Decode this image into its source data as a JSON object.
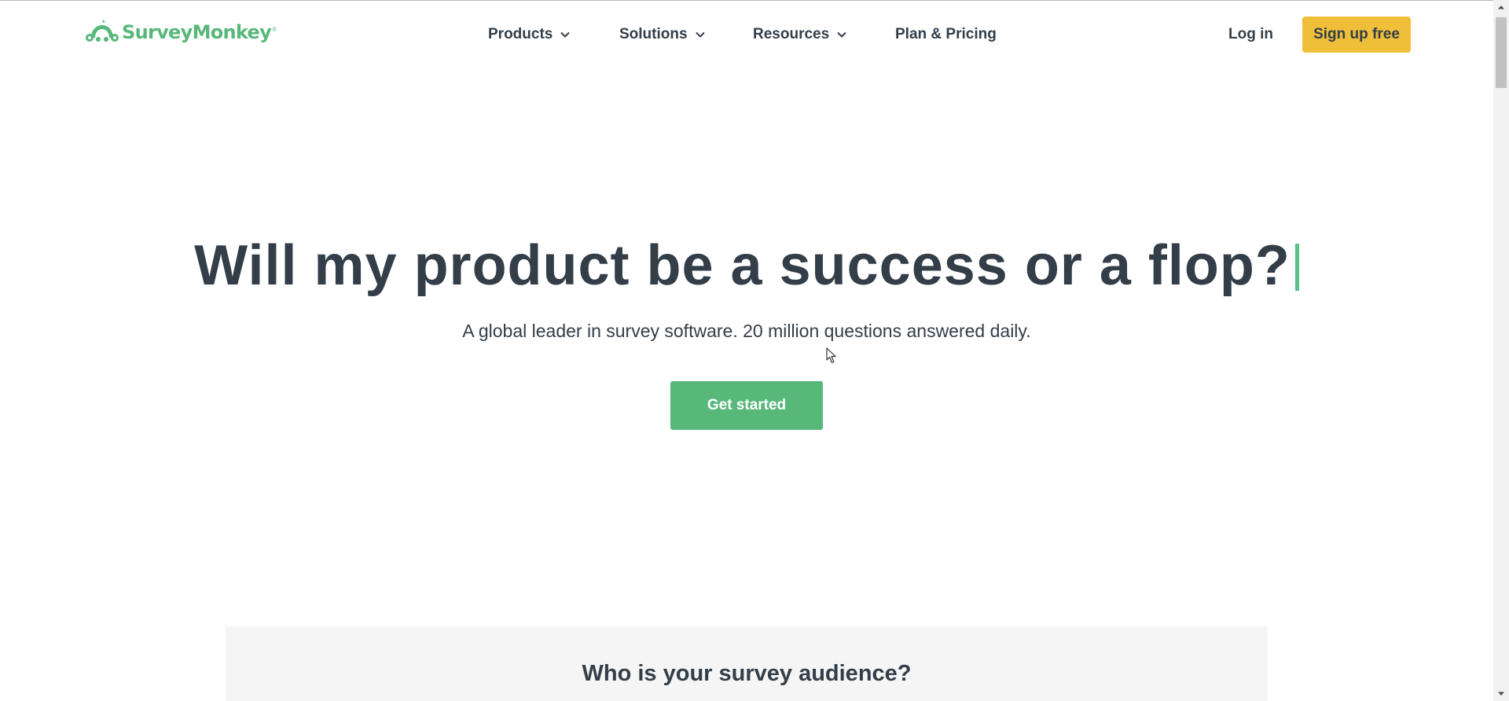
{
  "brand": {
    "name": "SurveyMonkey",
    "trademark": "®",
    "color": "#57b87a"
  },
  "nav": {
    "items": [
      {
        "label": "Products",
        "has_dropdown": true
      },
      {
        "label": "Solutions",
        "has_dropdown": true
      },
      {
        "label": "Resources",
        "has_dropdown": true
      },
      {
        "label": "Plan & Pricing",
        "has_dropdown": false
      }
    ],
    "login_label": "Log in",
    "signup_label": "Sign up free"
  },
  "hero": {
    "title": "Will my product be a success or a flop?",
    "subtitle": "A global leader in survey software. 20 million questions answered daily.",
    "cta_label": "Get started"
  },
  "audience": {
    "title": "Who is your survey audience?"
  },
  "colors": {
    "accent_green": "#57b87a",
    "signup_yellow": "#f0bf3a",
    "text_dark": "#333e48",
    "panel_bg": "#f5f5f5"
  },
  "icons": [
    "surveymonkey-logo-icon",
    "chevron-down-icon",
    "mouse-pointer-icon",
    "scroll-up-arrow-icon",
    "scroll-down-arrow-icon"
  ]
}
